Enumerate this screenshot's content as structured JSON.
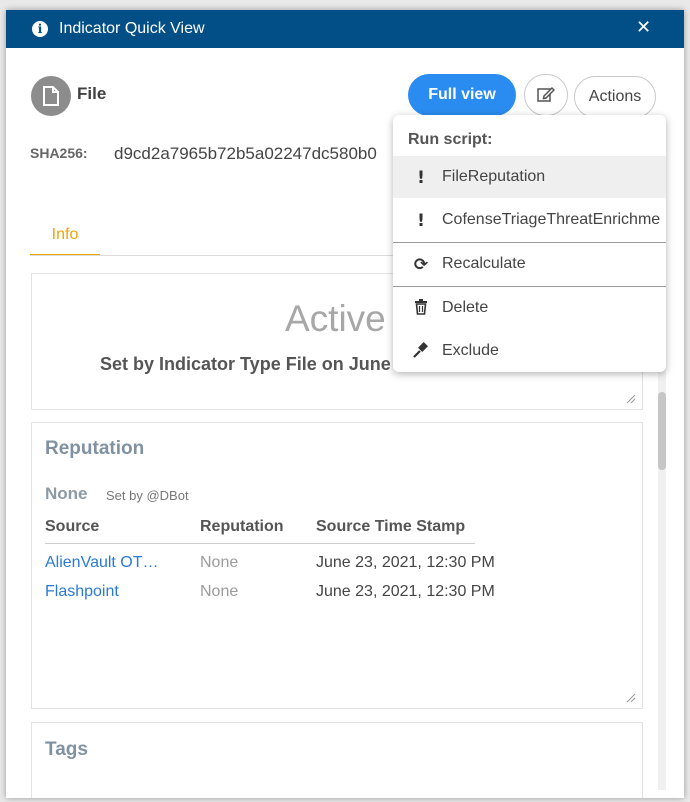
{
  "modal": {
    "title": "Indicator Quick View",
    "type_label": "File",
    "full_view_label": "Full view",
    "actions_label": "Actions",
    "sha_label": "SHA256:",
    "sha_value": "d9cd2a7965b72b5a02247dc580b0"
  },
  "tabs": [
    {
      "label": "Info"
    }
  ],
  "status": {
    "value": "Active",
    "set_by": "Set by Indicator Type File on June"
  },
  "reputation": {
    "title": "Reputation",
    "value": "None",
    "set_by": "Set by @DBot",
    "columns": [
      "Source",
      "Reputation",
      "Source Time Stamp"
    ],
    "rows": [
      {
        "source": "AlienVault OT…",
        "reputation": "None",
        "timestamp": "June 23, 2021, 12:30 PM"
      },
      {
        "source": "Flashpoint",
        "reputation": "None",
        "timestamp": "June 23, 2021, 12:30 PM"
      }
    ]
  },
  "tags": {
    "title": "Tags"
  },
  "actions_menu": {
    "header": "Run script:",
    "items": [
      {
        "label": "FileReputation",
        "icon": "exclamation-icon"
      },
      {
        "label": "CofenseTriageThreatEnrichme",
        "icon": "exclamation-icon"
      },
      {
        "label": "Recalculate",
        "icon": "refresh-icon"
      },
      {
        "label": "Delete",
        "icon": "trash-icon"
      },
      {
        "label": "Exclude",
        "icon": "gavel-icon"
      }
    ]
  },
  "colors": {
    "titlebar": "#014f86",
    "primary_button": "#2a8cf0",
    "active_tab": "#f0a500",
    "link": "#2a7ad5"
  }
}
